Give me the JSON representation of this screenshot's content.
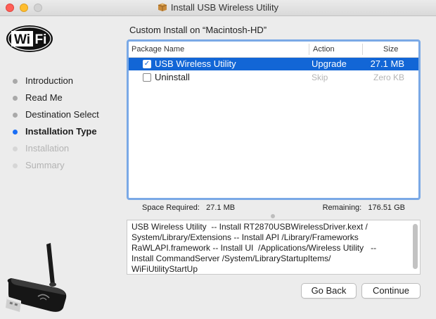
{
  "window": {
    "title": "Install USB Wireless Utility",
    "title_icon": "package-icon"
  },
  "sidebar": {
    "logo": {
      "name": "wifi-logo",
      "text_left": "Wi",
      "text_right": "Fi"
    },
    "steps": [
      {
        "label": "Introduction",
        "state": "done"
      },
      {
        "label": "Read Me",
        "state": "done"
      },
      {
        "label": "Destination Select",
        "state": "done"
      },
      {
        "label": "Installation Type",
        "state": "active"
      },
      {
        "label": "Installation",
        "state": "disabled"
      },
      {
        "label": "Summary",
        "state": "disabled"
      }
    ],
    "illustration": "usb-wireless-adapter"
  },
  "main": {
    "heading": "Custom Install on “Macintosh-HD”",
    "table": {
      "columns": {
        "name": "Package Name",
        "action": "Action",
        "size": "Size"
      },
      "rows": [
        {
          "checked": true,
          "name": "USB Wireless Utility",
          "action": "Upgrade",
          "size": "27.1 MB",
          "selected": true
        },
        {
          "checked": false,
          "name": "Uninstall",
          "action": "Skip",
          "size": "Zero KB",
          "selected": false
        }
      ]
    },
    "space": {
      "required_label": "Space Required:",
      "required_value": "27.1 MB",
      "remaining_label": "Remaining:",
      "remaining_value": "176.51 GB"
    },
    "description": "USB Wireless Utility  -- Install RT2870USBWirelessDriver.kext /\nSystem/Library/Extensions -- Install API /Library/Frameworks\nRaWLAPI.framework -- Install UI  /Applications/Wireless Utility   --\nInstall CommandServer /System/LibraryStartupItems/\nWiFiUtilityStartUp"
  },
  "buttons": {
    "back": "Go Back",
    "continue": "Continue"
  },
  "colors": {
    "accent": "#1a6ef5",
    "selection": "#1266d6",
    "focus_ring": "#7aa9e6"
  }
}
